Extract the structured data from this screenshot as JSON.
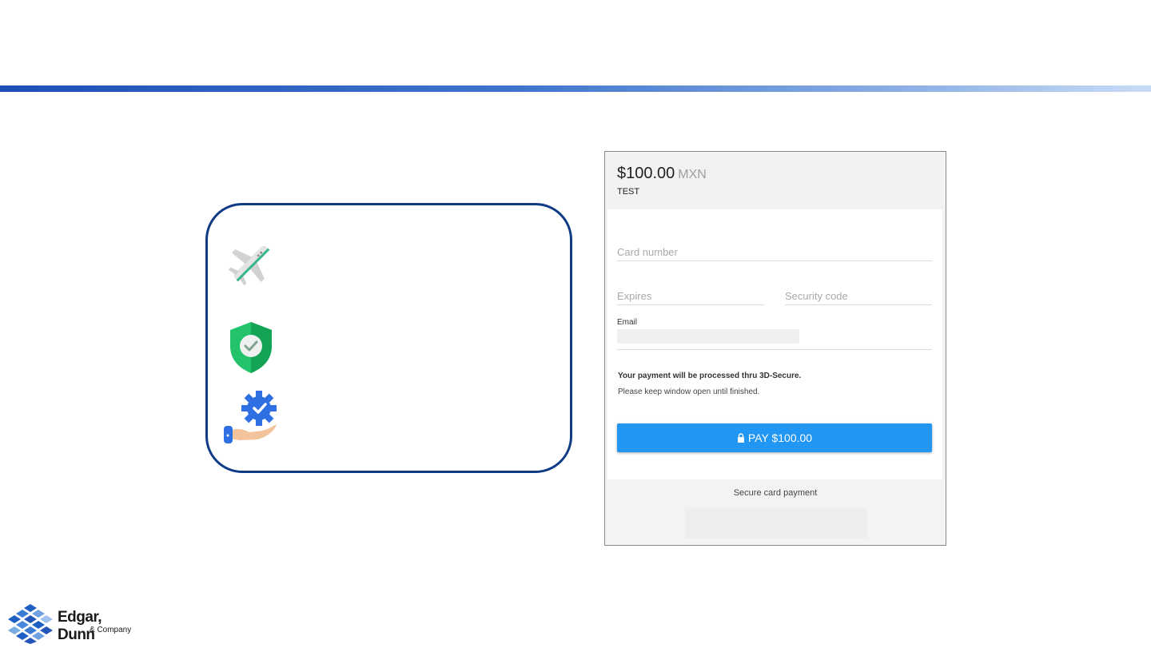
{
  "checkout": {
    "amount": "$100.00",
    "currency": "MXN",
    "merchant": "TEST",
    "card_number_placeholder": "Card number",
    "expires_placeholder": "Expires",
    "security_code_placeholder": "Security code",
    "email_label": "Email",
    "notice_bold": "Your payment will be processed thru 3D-Secure.",
    "notice_text": "Please keep window open until finished.",
    "pay_label": "PAY $100.00",
    "footer_text": "Secure card payment"
  },
  "features": {
    "icons": [
      "airplane-icon",
      "shield-check-icon",
      "hand-gear-icon"
    ]
  },
  "logo": {
    "name": "Edgar, Dunn",
    "sub": "& Company"
  },
  "colors": {
    "accent_blue": "#1d4fb8",
    "box_border": "#0e3a86",
    "pay_button": "#2196f3",
    "shield_green": "#22c36b"
  }
}
